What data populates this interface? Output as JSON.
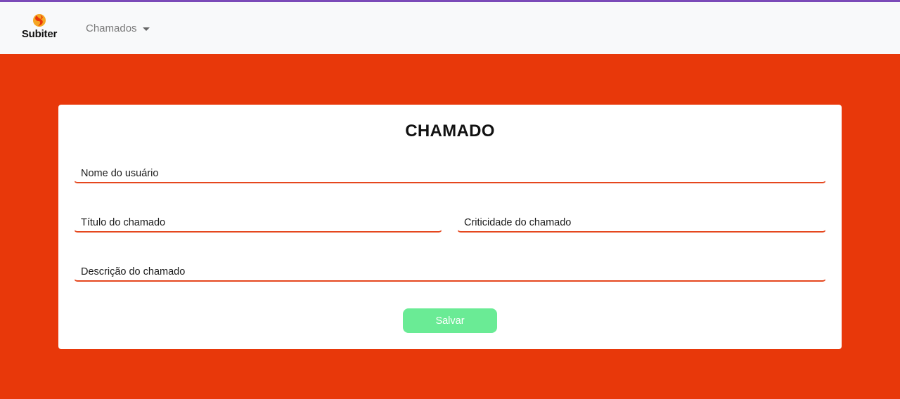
{
  "navbar": {
    "brand_name": "Subiter",
    "brand_icon": "flame-logo-icon",
    "menu_label": "Chamados",
    "menu_icon": "caret-down-icon"
  },
  "form": {
    "title": "CHAMADO",
    "fields": {
      "nome_usuario": {
        "placeholder": "Nome do usuário",
        "value": ""
      },
      "titulo": {
        "placeholder": "Título do chamado",
        "value": ""
      },
      "criticidade": {
        "placeholder": "Criticidade do chamado",
        "value": ""
      },
      "descricao": {
        "placeholder": "Descrição do chamado",
        "value": ""
      }
    },
    "save_label": "Salvar"
  },
  "colors": {
    "background": "#e8380a",
    "navbar": "#f8f9fa",
    "top_accent": "#7b4bb8",
    "field_underline": "#e5471e",
    "save_button": "#6aeb95"
  }
}
